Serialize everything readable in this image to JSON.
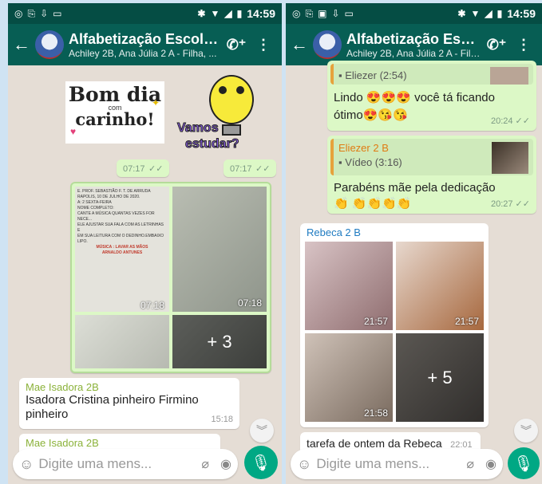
{
  "status": {
    "time": "14:59"
  },
  "header": {
    "title": "Alfabetização Escola 2...",
    "subtitle": "Achiley  2B, Ana Júlia 2 A - Filha, ..."
  },
  "input_placeholder": "Digite uma mens...",
  "left": {
    "sticker1": {
      "line1": "Bom dia",
      "line2": "com",
      "line3": "carinho!",
      "time": "07:17"
    },
    "sticker2": {
      "line1": "Vamos",
      "line2": "estudar?",
      "time": "07:17"
    },
    "album": {
      "doc_lines": [
        "E. PROF. SEBASTIÃO F. T. DE ARRUDA",
        "RAPOLIS, 10 DE JULHO DE 2020.",
        "A: 2 SEXTA-FEIRA",
        "NOME COMPLETO:",
        "CANTE A MÚSICA QUANTAS VEZES FOR NECE...",
        "ELE AJUSTAR SUA FALA COM AS LETRINHAS E",
        "EM SUA LEITURA COM O DEDINHO.EMBAIXO",
        "LIPO.",
        "MÚSICA : LAVAR AS MÃOS",
        "ARNALDO ANTUNES"
      ],
      "t1": "07:18",
      "t2": "07:18",
      "more": "+ 3"
    },
    "msg1": {
      "sender": "Mae Isadora 2B",
      "text": "Isadora Cristina pinheiro Firmino pinheiro",
      "time": "15:18"
    },
    "msg2": {
      "sender": "Mae Isadora 2B"
    }
  },
  "right": {
    "quote1": {
      "label": "▪ Eliezer (2:54)"
    },
    "msg1": {
      "text": "Lindo 😍😍😍 você tá ficando ótimo😍😘😘",
      "time": "20:24"
    },
    "quote2": {
      "name": "Eliezer 2 B",
      "label": "▪ Vídeo (3:16)"
    },
    "msg2": {
      "text": "Parabéns mãe pela dedicação👏 👏👏👏👏",
      "time": "20:27"
    },
    "album": {
      "sender": "Rebeca 2 B",
      "t1": "21:57",
      "t2": "21:57",
      "t3": "21:58",
      "more": "+ 5"
    },
    "caption": {
      "text": "tarefa de ontem da Rebeca",
      "time": "22:01"
    }
  }
}
